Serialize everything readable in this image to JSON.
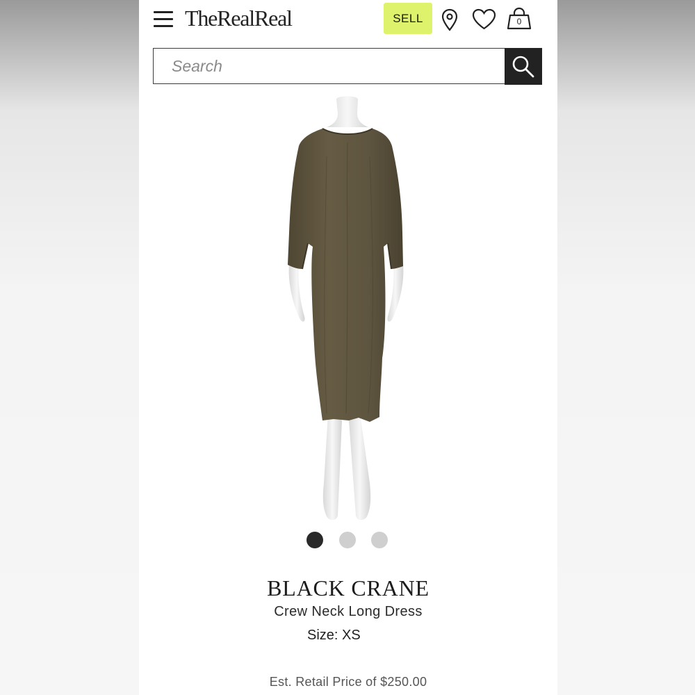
{
  "header": {
    "logo": "TheRealReal",
    "sell_label": "SELL",
    "bag_count": "0",
    "icons": [
      "menu-icon",
      "location-pin-icon",
      "heart-icon",
      "shopping-bag-icon"
    ]
  },
  "search": {
    "placeholder": "Search",
    "value": "",
    "button_icon": "search-icon"
  },
  "carousel": {
    "total_images": 3,
    "active_index": 0
  },
  "product": {
    "brand": "BLACK CRANE",
    "name": "Crew Neck Long Dress",
    "size_label": "Size:",
    "size_value": "XS",
    "retail_price": "Est. Retail Price of $250.00"
  },
  "colors": {
    "sell_accent": "#dff26b",
    "dress": "#5f5640",
    "search_button": "#222222"
  }
}
